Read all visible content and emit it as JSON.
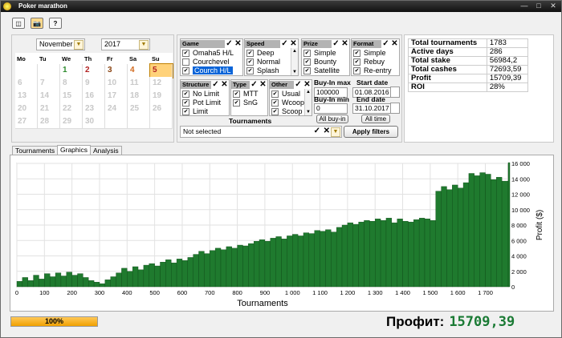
{
  "window": {
    "title": "Poker marathon"
  },
  "calendar": {
    "month": "November",
    "year": "2017",
    "weekdays": [
      "Mo",
      "Tu",
      "We",
      "Th",
      "Fr",
      "Sa",
      "Su"
    ],
    "rows": [
      [
        "",
        "",
        "1",
        "2",
        "3",
        "4",
        "5"
      ],
      [
        "6",
        "7",
        "8",
        "9",
        "10",
        "11",
        "12"
      ],
      [
        "13",
        "14",
        "15",
        "16",
        "17",
        "18",
        "19"
      ],
      [
        "20",
        "21",
        "22",
        "23",
        "24",
        "25",
        "26"
      ],
      [
        "27",
        "28",
        "29",
        "30",
        "",
        "",
        ""
      ]
    ],
    "active_days": [
      "1",
      "2",
      "3",
      "4",
      "5"
    ],
    "day_colors": {
      "1": "#2e8b2e",
      "2": "#b22222",
      "3": "#8b4513",
      "4": "#d2691e",
      "5": "#b22222"
    },
    "selected": "5"
  },
  "filters": {
    "game": {
      "label": "Game",
      "items": [
        {
          "text": "Omaha5 H/L",
          "checked": true
        },
        {
          "text": "Courchevel",
          "checked": false
        },
        {
          "text": "Courch H/L",
          "checked": true,
          "selected": true
        }
      ]
    },
    "speed": {
      "label": "Speed",
      "items": [
        {
          "text": "Deep",
          "checked": true
        },
        {
          "text": "Normal",
          "checked": true
        },
        {
          "text": "Splash",
          "checked": true
        }
      ]
    },
    "prize": {
      "label": "Prize",
      "items": [
        {
          "text": "Simple",
          "checked": true
        },
        {
          "text": "Bounty",
          "checked": true
        },
        {
          "text": "Satellite",
          "checked": true
        }
      ]
    },
    "format": {
      "label": "Format",
      "items": [
        {
          "text": "Simple",
          "checked": true
        },
        {
          "text": "Rebuy",
          "checked": true
        },
        {
          "text": "Re-entry",
          "checked": true
        }
      ]
    },
    "structure": {
      "label": "Structure",
      "items": [
        {
          "text": "No Limit",
          "checked": true
        },
        {
          "text": "Pot Limit",
          "checked": true
        },
        {
          "text": "Limit",
          "checked": true
        }
      ]
    },
    "type": {
      "label": "Type",
      "items": [
        {
          "text": "MTT",
          "checked": true
        },
        {
          "text": "SnG",
          "checked": true
        }
      ]
    },
    "other": {
      "label": "Other",
      "items": [
        {
          "text": "Usual",
          "checked": true
        },
        {
          "text": "Wcoop",
          "checked": true
        },
        {
          "text": "Scoop",
          "checked": true
        }
      ]
    },
    "buyin_max_label": "Buy-In max",
    "buyin_max": "100000",
    "buyin_min_label": "Buy-In min",
    "buyin_min": "0",
    "all_buyin": "All buy-in",
    "start_date_label": "Start date",
    "start_date": "01.08.2016",
    "end_date_label": "End date",
    "end_date": "31.10.2017",
    "all_time": "All time",
    "tournaments_label": "Tournaments",
    "tournaments_value": "Not selected",
    "apply": "Apply filters"
  },
  "stats": [
    {
      "label": "Total tournaments",
      "value": "1783"
    },
    {
      "label": "Active days",
      "value": "286"
    },
    {
      "label": "Total stake",
      "value": "56984,2"
    },
    {
      "label": "Total cashes",
      "value": "72693,59"
    },
    {
      "label": "Profit",
      "value": "15709,39"
    },
    {
      "label": "ROI",
      "value": "28%"
    }
  ],
  "tabs": [
    {
      "label": "Tournaments"
    },
    {
      "label": "Graphics",
      "active": true
    },
    {
      "label": "Analysis"
    }
  ],
  "progress": "100%",
  "profit": {
    "label": "Профит:",
    "value": "15709,39"
  },
  "colors": {
    "bar": "#1f7a2e",
    "bar_edge": "#0e4a17",
    "accent_green": "#1a7a34",
    "selected_day": "#ffd27a"
  },
  "chart_data": {
    "type": "bar",
    "xlabel": "Tournaments",
    "ylabel": "Profit ($)",
    "xlim": [
      0,
      1783
    ],
    "ylim": [
      0,
      16000
    ],
    "x_ticks": [
      0,
      100,
      200,
      300,
      400,
      500,
      600,
      700,
      800,
      900,
      1000,
      1100,
      1200,
      1300,
      1400,
      1500,
      1600,
      1700
    ],
    "x_tick_labels": [
      "0",
      "100",
      "200",
      "300",
      "400",
      "500",
      "600",
      "700",
      "800",
      "900",
      "1 000",
      "1 100",
      "1 200",
      "1 300",
      "1 400",
      "1 500",
      "1 600",
      "1 700"
    ],
    "y_ticks": [
      0,
      2000,
      4000,
      6000,
      8000,
      10000,
      12000,
      14000,
      16000
    ],
    "y_tick_labels": [
      "0",
      "2 000",
      "4 000",
      "6 000",
      "8 000",
      "10 000",
      "12 000",
      "14 000",
      "16 000"
    ],
    "grid": true,
    "series": [
      {
        "x": [
          0,
          20,
          40,
          60,
          80,
          100,
          120,
          140,
          160,
          180,
          200,
          220,
          240,
          260,
          280,
          300,
          320,
          340,
          360,
          380,
          400,
          420,
          440,
          460,
          480,
          500,
          520,
          540,
          560,
          580,
          600,
          620,
          640,
          660,
          680,
          700,
          720,
          740,
          760,
          780,
          800,
          820,
          840,
          860,
          880,
          900,
          920,
          940,
          960,
          980,
          1000,
          1020,
          1040,
          1060,
          1080,
          1100,
          1120,
          1140,
          1160,
          1180,
          1200,
          1220,
          1240,
          1260,
          1280,
          1300,
          1320,
          1340,
          1360,
          1380,
          1400,
          1420,
          1440,
          1460,
          1480,
          1500,
          1520,
          1540,
          1560,
          1580,
          1600,
          1620,
          1640,
          1660,
          1680,
          1700,
          1720,
          1740,
          1760,
          1783
        ],
        "y": [
          700,
          1200,
          800,
          1500,
          1000,
          1700,
          1300,
          1800,
          1400,
          1900,
          1500,
          1700,
          1200,
          800,
          600,
          400,
          900,
          1300,
          1800,
          2400,
          2000,
          2600,
          2200,
          2800,
          3000,
          2700,
          3200,
          3500,
          3100,
          3600,
          3400,
          3800,
          4200,
          4600,
          4300,
          4700,
          5000,
          4800,
          5200,
          5000,
          5400,
          5300,
          5600,
          5900,
          6100,
          5900,
          6300,
          6500,
          6200,
          6600,
          6800,
          6600,
          7000,
          6900,
          7300,
          7200,
          7400,
          7100,
          7700,
          8000,
          8300,
          8100,
          8400,
          8600,
          8500,
          8800,
          8600,
          8900,
          8300,
          8800,
          8500,
          8400,
          8700,
          8900,
          8800,
          8600,
          12400,
          13000,
          12600,
          13200,
          12800,
          13500,
          14700,
          14400,
          14800,
          14600,
          13900,
          14200,
          13700,
          16100
        ]
      }
    ]
  }
}
